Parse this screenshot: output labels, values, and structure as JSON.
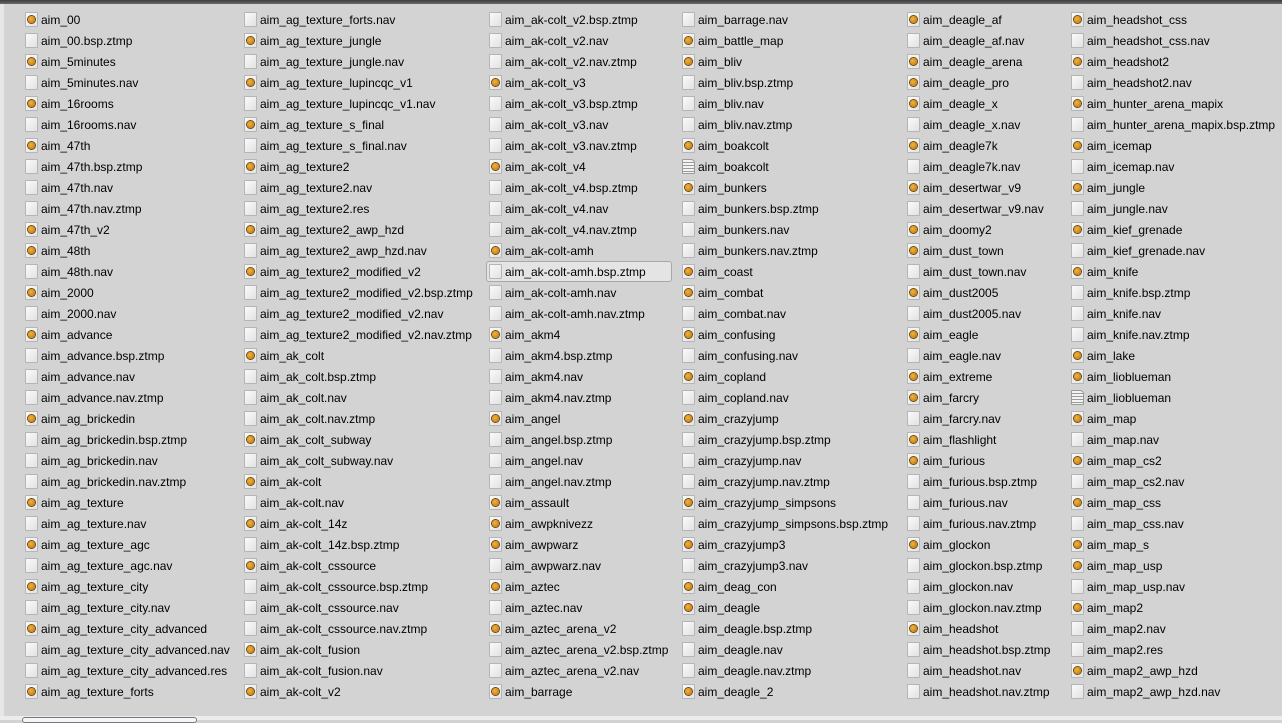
{
  "file_list": {
    "columns": [
      [
        [
          "aim_00",
          "bsp"
        ],
        [
          "aim_00.bsp.ztmp",
          "blank"
        ],
        [
          "aim_5minutes",
          "bsp"
        ],
        [
          "aim_5minutes.nav",
          "blank"
        ],
        [
          "aim_16rooms",
          "bsp"
        ],
        [
          "aim_16rooms.nav",
          "blank"
        ],
        [
          "aim_47th",
          "bsp"
        ],
        [
          "aim_47th.bsp.ztmp",
          "blank"
        ],
        [
          "aim_47th.nav",
          "blank"
        ],
        [
          "aim_47th.nav.ztmp",
          "blank"
        ],
        [
          "aim_47th_v2",
          "bsp"
        ],
        [
          "aim_48th",
          "bsp"
        ],
        [
          "aim_48th.nav",
          "blank"
        ],
        [
          "aim_2000",
          "bsp"
        ],
        [
          "aim_2000.nav",
          "blank"
        ],
        [
          "aim_advance",
          "bsp"
        ],
        [
          "aim_advance.bsp.ztmp",
          "blank"
        ],
        [
          "aim_advance.nav",
          "blank"
        ],
        [
          "aim_advance.nav.ztmp",
          "blank"
        ],
        [
          "aim_ag_brickedin",
          "bsp"
        ],
        [
          "aim_ag_brickedin.bsp.ztmp",
          "blank"
        ],
        [
          "aim_ag_brickedin.nav",
          "blank"
        ],
        [
          "aim_ag_brickedin.nav.ztmp",
          "blank"
        ],
        [
          "aim_ag_texture",
          "bsp"
        ],
        [
          "aim_ag_texture.nav",
          "blank"
        ],
        [
          "aim_ag_texture_agc",
          "bsp"
        ],
        [
          "aim_ag_texture_agc.nav",
          "blank"
        ],
        [
          "aim_ag_texture_city",
          "bsp"
        ],
        [
          "aim_ag_texture_city.nav",
          "blank"
        ],
        [
          "aim_ag_texture_city_advanced",
          "bsp"
        ],
        [
          "aim_ag_texture_city_advanced.nav",
          "blank"
        ],
        [
          "aim_ag_texture_city_advanced.res",
          "blank"
        ],
        [
          "aim_ag_texture_forts",
          "bsp"
        ]
      ],
      [
        [
          "aim_ag_texture_forts.nav",
          "blank"
        ],
        [
          "aim_ag_texture_jungle",
          "bsp"
        ],
        [
          "aim_ag_texture_jungle.nav",
          "blank"
        ],
        [
          "aim_ag_texture_lupincqc_v1",
          "bsp"
        ],
        [
          "aim_ag_texture_lupincqc_v1.nav",
          "blank"
        ],
        [
          "aim_ag_texture_s_final",
          "bsp"
        ],
        [
          "aim_ag_texture_s_final.nav",
          "blank"
        ],
        [
          "aim_ag_texture2",
          "bsp"
        ],
        [
          "aim_ag_texture2.nav",
          "blank"
        ],
        [
          "aim_ag_texture2.res",
          "blank"
        ],
        [
          "aim_ag_texture2_awp_hzd",
          "bsp"
        ],
        [
          "aim_ag_texture2_awp_hzd.nav",
          "blank"
        ],
        [
          "aim_ag_texture2_modified_v2",
          "bsp"
        ],
        [
          "aim_ag_texture2_modified_v2.bsp.ztmp",
          "blank"
        ],
        [
          "aim_ag_texture2_modified_v2.nav",
          "blank"
        ],
        [
          "aim_ag_texture2_modified_v2.nav.ztmp",
          "blank"
        ],
        [
          "aim_ak_colt",
          "bsp"
        ],
        [
          "aim_ak_colt.bsp.ztmp",
          "blank"
        ],
        [
          "aim_ak_colt.nav",
          "blank"
        ],
        [
          "aim_ak_colt.nav.ztmp",
          "blank"
        ],
        [
          "aim_ak_colt_subway",
          "bsp"
        ],
        [
          "aim_ak_colt_subway.nav",
          "blank"
        ],
        [
          "aim_ak-colt",
          "bsp"
        ],
        [
          "aim_ak-colt.nav",
          "blank"
        ],
        [
          "aim_ak-colt_14z",
          "bsp"
        ],
        [
          "aim_ak-colt_14z.bsp.ztmp",
          "blank"
        ],
        [
          "aim_ak-colt_cssource",
          "bsp"
        ],
        [
          "aim_ak-colt_cssource.bsp.ztmp",
          "blank"
        ],
        [
          "aim_ak-colt_cssource.nav",
          "blank"
        ],
        [
          "aim_ak-colt_cssource.nav.ztmp",
          "blank"
        ],
        [
          "aim_ak-colt_fusion",
          "bsp"
        ],
        [
          "aim_ak-colt_fusion.nav",
          "blank"
        ],
        [
          "aim_ak-colt_v2",
          "bsp"
        ]
      ],
      [
        [
          "aim_ak-colt_v2.bsp.ztmp",
          "blank"
        ],
        [
          "aim_ak-colt_v2.nav",
          "blank"
        ],
        [
          "aim_ak-colt_v2.nav.ztmp",
          "blank"
        ],
        [
          "aim_ak-colt_v3",
          "bsp"
        ],
        [
          "aim_ak-colt_v3.bsp.ztmp",
          "blank"
        ],
        [
          "aim_ak-colt_v3.nav",
          "blank"
        ],
        [
          "aim_ak-colt_v3.nav.ztmp",
          "blank"
        ],
        [
          "aim_ak-colt_v4",
          "bsp"
        ],
        [
          "aim_ak-colt_v4.bsp.ztmp",
          "blank"
        ],
        [
          "aim_ak-colt_v4.nav",
          "blank"
        ],
        [
          "aim_ak-colt_v4.nav.ztmp",
          "blank"
        ],
        [
          "aim_ak-colt-amh",
          "bsp"
        ],
        [
          "aim_ak-colt-amh.bsp.ztmp",
          "blank"
        ],
        [
          "aim_ak-colt-amh.nav",
          "blank"
        ],
        [
          "aim_ak-colt-amh.nav.ztmp",
          "blank"
        ],
        [
          "aim_akm4",
          "bsp"
        ],
        [
          "aim_akm4.bsp.ztmp",
          "blank"
        ],
        [
          "aim_akm4.nav",
          "blank"
        ],
        [
          "aim_akm4.nav.ztmp",
          "blank"
        ],
        [
          "aim_angel",
          "bsp"
        ],
        [
          "aim_angel.bsp.ztmp",
          "blank"
        ],
        [
          "aim_angel.nav",
          "blank"
        ],
        [
          "aim_angel.nav.ztmp",
          "blank"
        ],
        [
          "aim_assault",
          "bsp"
        ],
        [
          "aim_awpknivezz",
          "bsp"
        ],
        [
          "aim_awpwarz",
          "bsp"
        ],
        [
          "aim_awpwarz.nav",
          "blank"
        ],
        [
          "aim_aztec",
          "bsp"
        ],
        [
          "aim_aztec.nav",
          "blank"
        ],
        [
          "aim_aztec_arena_v2",
          "bsp"
        ],
        [
          "aim_aztec_arena_v2.bsp.ztmp",
          "blank"
        ],
        [
          "aim_aztec_arena_v2.nav",
          "blank"
        ],
        [
          "aim_barrage",
          "bsp"
        ]
      ],
      [
        [
          "aim_barrage.nav",
          "blank"
        ],
        [
          "aim_battle_map",
          "bsp"
        ],
        [
          "aim_bliv",
          "bsp"
        ],
        [
          "aim_bliv.bsp.ztmp",
          "blank"
        ],
        [
          "aim_bliv.nav",
          "blank"
        ],
        [
          "aim_bliv.nav.ztmp",
          "blank"
        ],
        [
          "aim_boakcolt",
          "bsp"
        ],
        [
          "aim_boakcolt",
          "text"
        ],
        [
          "aim_bunkers",
          "bsp"
        ],
        [
          "aim_bunkers.bsp.ztmp",
          "blank"
        ],
        [
          "aim_bunkers.nav",
          "blank"
        ],
        [
          "aim_bunkers.nav.ztmp",
          "blank"
        ],
        [
          "aim_coast",
          "bsp"
        ],
        [
          "aim_combat",
          "bsp"
        ],
        [
          "aim_combat.nav",
          "blank"
        ],
        [
          "aim_confusing",
          "bsp"
        ],
        [
          "aim_confusing.nav",
          "blank"
        ],
        [
          "aim_copland",
          "bsp"
        ],
        [
          "aim_copland.nav",
          "blank"
        ],
        [
          "aim_crazyjump",
          "bsp"
        ],
        [
          "aim_crazyjump.bsp.ztmp",
          "blank"
        ],
        [
          "aim_crazyjump.nav",
          "blank"
        ],
        [
          "aim_crazyjump.nav.ztmp",
          "blank"
        ],
        [
          "aim_crazyjump_simpsons",
          "bsp"
        ],
        [
          "aim_crazyjump_simpsons.bsp.ztmp",
          "blank"
        ],
        [
          "aim_crazyjump3",
          "bsp"
        ],
        [
          "aim_crazyjump3.nav",
          "blank"
        ],
        [
          "aim_deag_con",
          "bsp"
        ],
        [
          "aim_deagle",
          "bsp"
        ],
        [
          "aim_deagle.bsp.ztmp",
          "blank"
        ],
        [
          "aim_deagle.nav",
          "blank"
        ],
        [
          "aim_deagle.nav.ztmp",
          "blank"
        ],
        [
          "aim_deagle_2",
          "bsp"
        ]
      ],
      [
        [
          "aim_deagle_af",
          "bsp"
        ],
        [
          "aim_deagle_af.nav",
          "blank"
        ],
        [
          "aim_deagle_arena",
          "bsp"
        ],
        [
          "aim_deagle_pro",
          "bsp"
        ],
        [
          "aim_deagle_x",
          "bsp"
        ],
        [
          "aim_deagle_x.nav",
          "blank"
        ],
        [
          "aim_deagle7k",
          "bsp"
        ],
        [
          "aim_deagle7k.nav",
          "blank"
        ],
        [
          "aim_desertwar_v9",
          "bsp"
        ],
        [
          "aim_desertwar_v9.nav",
          "blank"
        ],
        [
          "aim_doomy2",
          "bsp"
        ],
        [
          "aim_dust_town",
          "bsp"
        ],
        [
          "aim_dust_town.nav",
          "blank"
        ],
        [
          "aim_dust2005",
          "bsp"
        ],
        [
          "aim_dust2005.nav",
          "blank"
        ],
        [
          "aim_eagle",
          "bsp"
        ],
        [
          "aim_eagle.nav",
          "blank"
        ],
        [
          "aim_extreme",
          "bsp"
        ],
        [
          "aim_farcry",
          "bsp"
        ],
        [
          "aim_farcry.nav",
          "blank"
        ],
        [
          "aim_flashlight",
          "bsp"
        ],
        [
          "aim_furious",
          "bsp"
        ],
        [
          "aim_furious.bsp.ztmp",
          "blank"
        ],
        [
          "aim_furious.nav",
          "blank"
        ],
        [
          "aim_furious.nav.ztmp",
          "blank"
        ],
        [
          "aim_glockon",
          "bsp"
        ],
        [
          "aim_glockon.bsp.ztmp",
          "blank"
        ],
        [
          "aim_glockon.nav",
          "blank"
        ],
        [
          "aim_glockon.nav.ztmp",
          "blank"
        ],
        [
          "aim_headshot",
          "bsp"
        ],
        [
          "aim_headshot.bsp.ztmp",
          "blank"
        ],
        [
          "aim_headshot.nav",
          "blank"
        ],
        [
          "aim_headshot.nav.ztmp",
          "blank"
        ]
      ],
      [
        [
          "aim_headshot_css",
          "bsp"
        ],
        [
          "aim_headshot_css.nav",
          "blank"
        ],
        [
          "aim_headshot2",
          "bsp"
        ],
        [
          "aim_headshot2.nav",
          "blank"
        ],
        [
          "aim_hunter_arena_mapix",
          "bsp"
        ],
        [
          "aim_hunter_arena_mapix.bsp.ztmp",
          "blank"
        ],
        [
          "aim_icemap",
          "bsp"
        ],
        [
          "aim_icemap.nav",
          "blank"
        ],
        [
          "aim_jungle",
          "bsp"
        ],
        [
          "aim_jungle.nav",
          "blank"
        ],
        [
          "aim_kief_grenade",
          "bsp"
        ],
        [
          "aim_kief_grenade.nav",
          "blank"
        ],
        [
          "aim_knife",
          "bsp"
        ],
        [
          "aim_knife.bsp.ztmp",
          "blank"
        ],
        [
          "aim_knife.nav",
          "blank"
        ],
        [
          "aim_knife.nav.ztmp",
          "blank"
        ],
        [
          "aim_lake",
          "bsp"
        ],
        [
          "aim_lioblueman",
          "bsp"
        ],
        [
          "aim_lioblueman",
          "text"
        ],
        [
          "aim_map",
          "bsp"
        ],
        [
          "aim_map.nav",
          "blank"
        ],
        [
          "aim_map_cs2",
          "bsp"
        ],
        [
          "aim_map_cs2.nav",
          "blank"
        ],
        [
          "aim_map_css",
          "bsp"
        ],
        [
          "aim_map_css.nav",
          "blank"
        ],
        [
          "aim_map_s",
          "bsp"
        ],
        [
          "aim_map_usp",
          "bsp"
        ],
        [
          "aim_map_usp.nav",
          "blank"
        ],
        [
          "aim_map2",
          "bsp"
        ],
        [
          "aim_map2.nav",
          "blank"
        ],
        [
          "aim_map2.res",
          "blank"
        ],
        [
          "aim_map2_awp_hzd",
          "bsp"
        ],
        [
          "aim_map2_awp_hzd.nav",
          "blank"
        ]
      ]
    ],
    "selected": "aim_ak-colt-amh.bsp.ztmp",
    "icon_names": {
      "bsp": "map-file-icon",
      "blank": "blank-file-icon",
      "text": "text-file-icon"
    }
  }
}
